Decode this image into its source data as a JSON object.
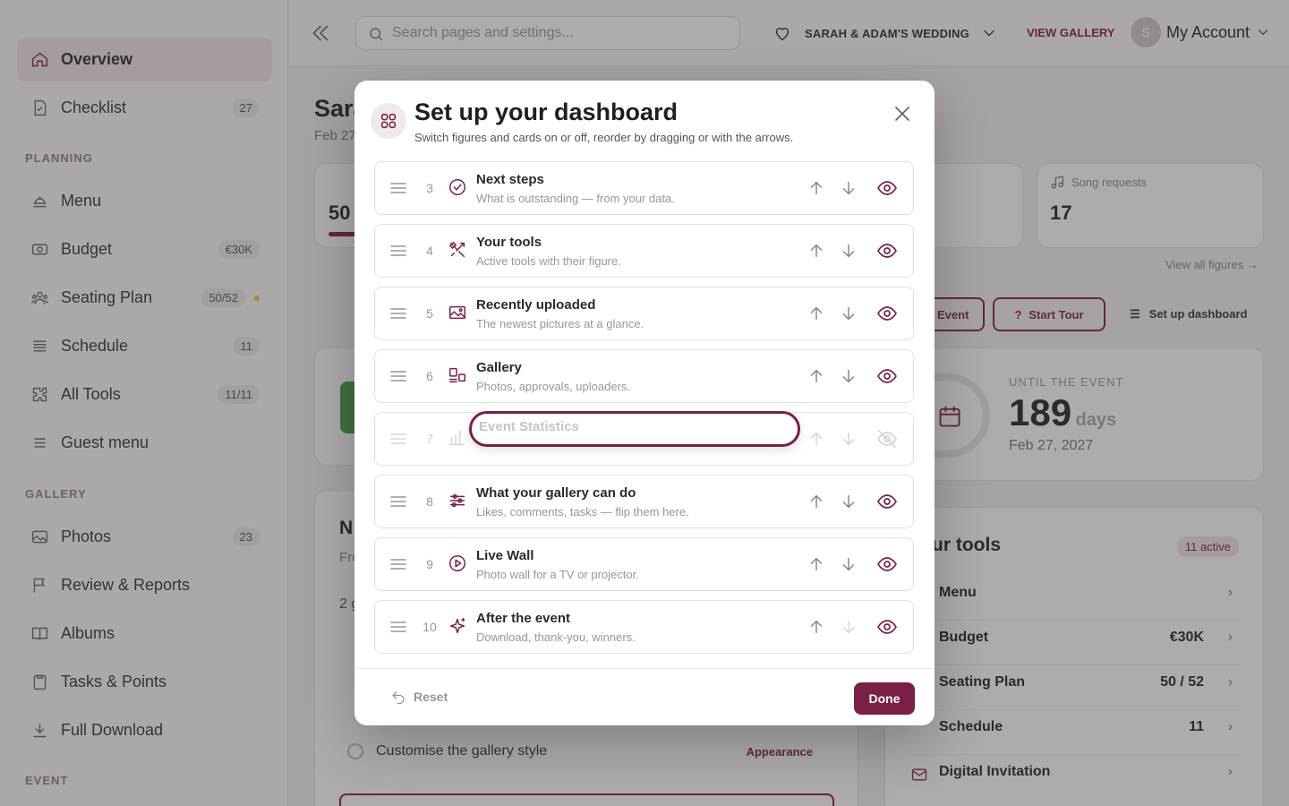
{
  "sidebar": {
    "items": [
      {
        "label": "Overview",
        "badge": "",
        "icon": "home-icon"
      },
      {
        "label": "Checklist",
        "badge": "27",
        "icon": "checklist-icon"
      },
      {
        "label": "Menu",
        "badge": "",
        "icon": "menu-food-icon"
      },
      {
        "label": "Budget",
        "badge": "€30K",
        "icon": "budget-icon"
      },
      {
        "label": "Seating Plan",
        "badge": "50/52",
        "icon": "people-icon"
      },
      {
        "label": "Schedule",
        "badge": "11",
        "icon": "schedule-icon"
      },
      {
        "label": "All Tools",
        "badge": "11/11",
        "icon": "puzzle-icon"
      },
      {
        "label": "Guest menu",
        "badge": "",
        "icon": "list-icon"
      },
      {
        "label": "Photos",
        "badge": "23",
        "icon": "photo-icon"
      },
      {
        "label": "Review & Reports",
        "badge": "",
        "icon": "flag-icon"
      },
      {
        "label": "Albums",
        "badge": "",
        "icon": "book-icon"
      },
      {
        "label": "Tasks & Points",
        "badge": "",
        "icon": "clipboard-icon"
      },
      {
        "label": "Full Download",
        "badge": "",
        "icon": "download-icon"
      }
    ],
    "sections": {
      "planning": "PLANNING",
      "gallery": "GALLERY",
      "event": "EVENT"
    }
  },
  "header": {
    "search_placeholder": "Search pages and settings...",
    "wedding_name": "SARAH & ADAM'S WEDDING",
    "view_gallery": "VIEW GALLERY",
    "account_label": "My Account",
    "avatar_initial": "S"
  },
  "background": {
    "page_title_partial": "Sara",
    "date_partial": "Feb 27",
    "stat_value_partial": "50",
    "song_requests_label": "Song requests",
    "song_requests_value": "17",
    "view_all_figures": "View all figures",
    "event_btn_partial": "Event",
    "start_tour": "Start Tour",
    "setup_dashboard": "Set up dashboard",
    "until_label": "UNTIL THE EVENT",
    "days_value": "189",
    "days_unit": "days",
    "event_date": "Feb 27, 2027",
    "tools_title_partial": "ur tools",
    "tools_active": "11 active",
    "tools": [
      {
        "name": "Menu",
        "value": ""
      },
      {
        "name": "Budget",
        "value": "€30K"
      },
      {
        "name": "Seating Plan",
        "value": "50 / 52"
      },
      {
        "name": "Schedule",
        "value": "11"
      },
      {
        "name": "Digital Invitation",
        "value": ""
      }
    ],
    "next_title_partial": "N",
    "next_sub_partial": "Fro",
    "next_count_partial": "2 g",
    "todo_item": "Customise the gallery style",
    "todo_action": "Appearance"
  },
  "modal": {
    "title": "Set up your dashboard",
    "subtitle": "Switch figures and cards on or off, reorder by dragging or with the arrows.",
    "rows": [
      {
        "num": "3",
        "title": "Next steps",
        "desc": "What is outstanding — from your data.",
        "icon": "check-circle-icon",
        "visible": true
      },
      {
        "num": "4",
        "title": "Your tools",
        "desc": "Active tools with their figure.",
        "icon": "tools-icon",
        "visible": true
      },
      {
        "num": "5",
        "title": "Recently uploaded",
        "desc": "The newest pictures at a glance.",
        "icon": "image-icon",
        "visible": true
      },
      {
        "num": "6",
        "title": "Gallery",
        "desc": "Photos, approvals, uploaders.",
        "icon": "gallery-icon",
        "visible": true
      },
      {
        "num": "7",
        "title": "Event Statistics",
        "desc": "",
        "icon": "bar-chart-icon",
        "visible": false
      },
      {
        "num": "8",
        "title": "What your gallery can do",
        "desc": "Likes, comments, tasks — flip them here.",
        "icon": "sliders-icon",
        "visible": true
      },
      {
        "num": "9",
        "title": "Live Wall",
        "desc": "Photo wall for a TV or projector.",
        "icon": "play-circle-icon",
        "visible": true
      },
      {
        "num": "10",
        "title": "After the event",
        "desc": "Download, thank-you, winners.",
        "icon": "sparkle-icon",
        "visible": true
      }
    ],
    "dragging_label": "Event Statistics",
    "reset_label": "Reset",
    "done_label": "Done"
  },
  "colors": {
    "accent": "#7a1f45",
    "overlay": "#3c3737"
  }
}
